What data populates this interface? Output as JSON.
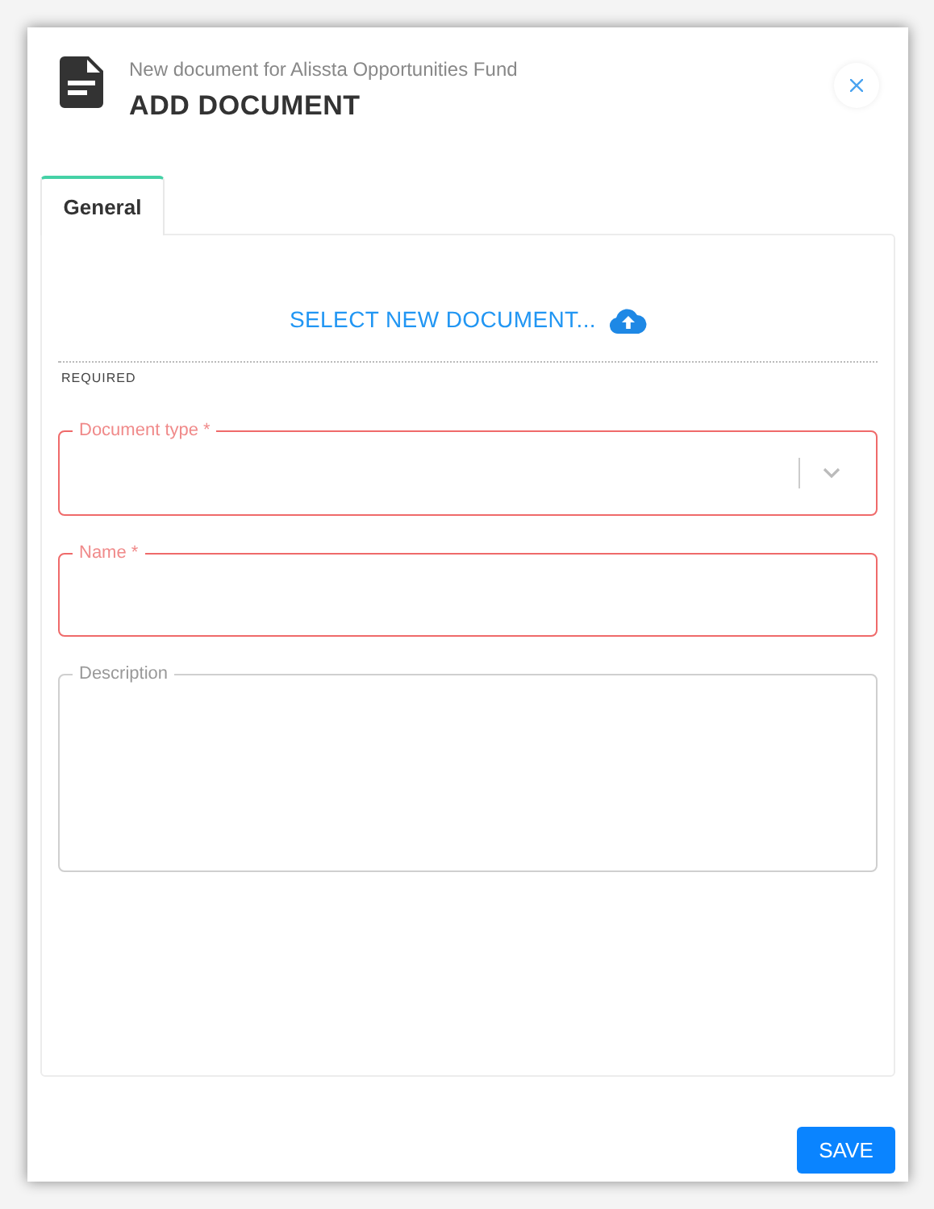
{
  "header": {
    "subtitle": "New document for Alissta Opportunities Fund",
    "title": "ADD DOCUMENT"
  },
  "tabs": [
    {
      "label": "General",
      "selected": true
    }
  ],
  "upload": {
    "label": "SELECT NEW DOCUMENT..."
  },
  "required_note": "REQUIRED",
  "fields": [
    {
      "kind": "select",
      "label": "Document type *",
      "error": true
    },
    {
      "kind": "text",
      "label": "Name *",
      "error": true
    },
    {
      "kind": "textarea",
      "label": "Description",
      "error": false
    }
  ],
  "buttons": [
    {
      "label": "SAVE"
    }
  ]
}
